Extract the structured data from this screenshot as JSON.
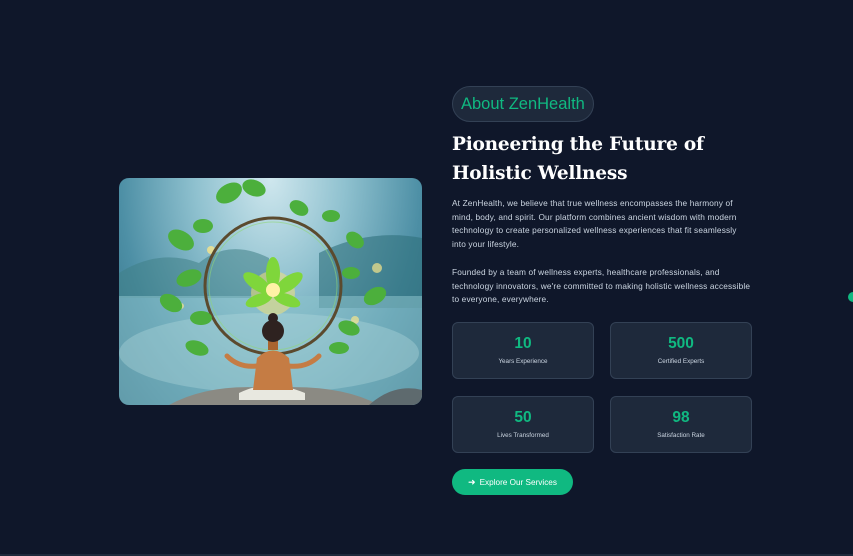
{
  "about": {
    "badge": "About ZenHealth",
    "heading": "Pioneering the Future of Holistic Wellness",
    "paragraph_1": "At ZenHealth, we believe that true wellness encompasses the harmony of mind, body, and spirit. Our platform combines ancient wisdom with modern technology to create personalized wellness experiences that fit seamlessly into your lifestyle.",
    "paragraph_2": "Founded by a team of wellness experts, healthcare professionals, and technology innovators, we're committed to making holistic wellness accessible to everyone, everywhere."
  },
  "stats": [
    {
      "value": "10",
      "label": "Years Experience"
    },
    {
      "value": "500",
      "label": "Certified Experts"
    },
    {
      "value": "50",
      "label": "Lives Transformed"
    },
    {
      "value": "98",
      "label": "Satisfaction Rate"
    }
  ],
  "cta": {
    "label": "Explore Our Services",
    "icon": "arrow-right-icon"
  },
  "colors": {
    "background": "#0f172a",
    "accent": "#10b981",
    "card": "#1e293b",
    "border": "#334155"
  }
}
